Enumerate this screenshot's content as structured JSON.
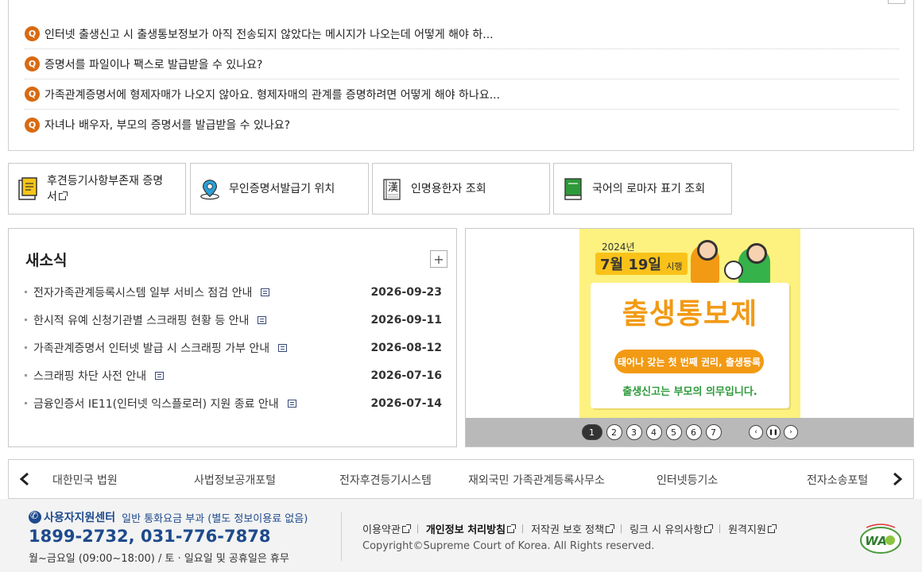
{
  "faq": {
    "items": [
      {
        "badge": "Q",
        "text": "인터넷 출생신고 시 출생통보정보가 아직 전송되지 않았다는 메시지가 나오는데 어떻게 해야 하..."
      },
      {
        "badge": "Q",
        "text": "증명서를 파일이나 팩스로 발급받을 수 있나요?"
      },
      {
        "badge": "Q",
        "text": "가족관계증명서에 형제자매가 나오지 않아요. 형제자매의 관계를 증명하려면 어떻게 해야 하나요..."
      },
      {
        "badge": "Q",
        "text": "자녀나 배우자, 부모의 증명서를 발급받을 수 있나요?"
      }
    ]
  },
  "quick_links": [
    {
      "label_line1": "후견등기사항부존재 증명",
      "label_line2": "서",
      "icon": "certificate-doc-icon"
    },
    {
      "label": "무인증명서발급기 위치",
      "icon": "location-pin-icon"
    },
    {
      "label": "인명용한자 조회",
      "icon": "hanja-book-icon"
    },
    {
      "label": "국어의 로마자 표기 조회",
      "icon": "green-book-icon"
    }
  ],
  "hanja_glyph": "漢",
  "news": {
    "title": "새소식",
    "more_label": "+",
    "items": [
      {
        "text": "전자가족관계등록시스템 일부 서비스 점검 안내",
        "date": "2026-09-23"
      },
      {
        "text": "한시적 유예 신청기관별 스크래핑 현황 등 안내",
        "date": "2026-09-11"
      },
      {
        "text": "가족관계증명서 인터넷 발급 시 스크래핑 가부 안내",
        "date": "2026-08-12"
      },
      {
        "text": "스크래핑 차단 사전 안내",
        "date": "2026-07-16"
      },
      {
        "text": "금융인증서 IE11(인터넷 익스플로러) 지원 종료 안내",
        "date": "2026-07-14"
      }
    ]
  },
  "banner": {
    "year": "2024년",
    "date_main": "7월 19일",
    "date_suffix": "시행",
    "title": "출생통보제",
    "pill": "태어나 갖는 첫 번째 권리, 출생등록",
    "subtitle": "출생신고는 부모의 의무입니다.",
    "pages": [
      "1",
      "2",
      "3",
      "4",
      "5",
      "6",
      "7"
    ],
    "active_page": "1",
    "prev_glyph": "‹",
    "pause_glyph": "❚❚",
    "next_glyph": "›"
  },
  "related_sites": [
    "대한민국 법원",
    "사법정보공개포털",
    "전자후견등기시스템",
    "재외국민 가족관계등록사무소",
    "인터넷등기소",
    "전자소송포털"
  ],
  "footer": {
    "support_title": "사용자지원센터",
    "support_note": "일반 통화요금 부과 (별도 정보이용료 없음)",
    "phone": "1899-2732, 031-776-7878",
    "hours": "월~금요일 (09:00~18:00) / 토 · 일요일 및 공휴일은 휴무",
    "links": [
      {
        "label": "이용약관",
        "bold": false
      },
      {
        "label": "개인정보 처리방침",
        "bold": true
      },
      {
        "label": "저작권 보호 정책",
        "bold": false
      },
      {
        "label": "링크 시 유의사항",
        "bold": false
      },
      {
        "label": "원격지원",
        "bold": false
      }
    ],
    "copyright": "Copyright©Supreme Court of Korea. All Rights reserved.",
    "wa_text": "WA"
  },
  "colors": {
    "accent_orange": "#d86a12",
    "brand_blue": "#1e4a8c",
    "banner_yellow": "#fdf17f",
    "banner_orange": "#f29a14",
    "banner_green": "#2e9a3a"
  }
}
